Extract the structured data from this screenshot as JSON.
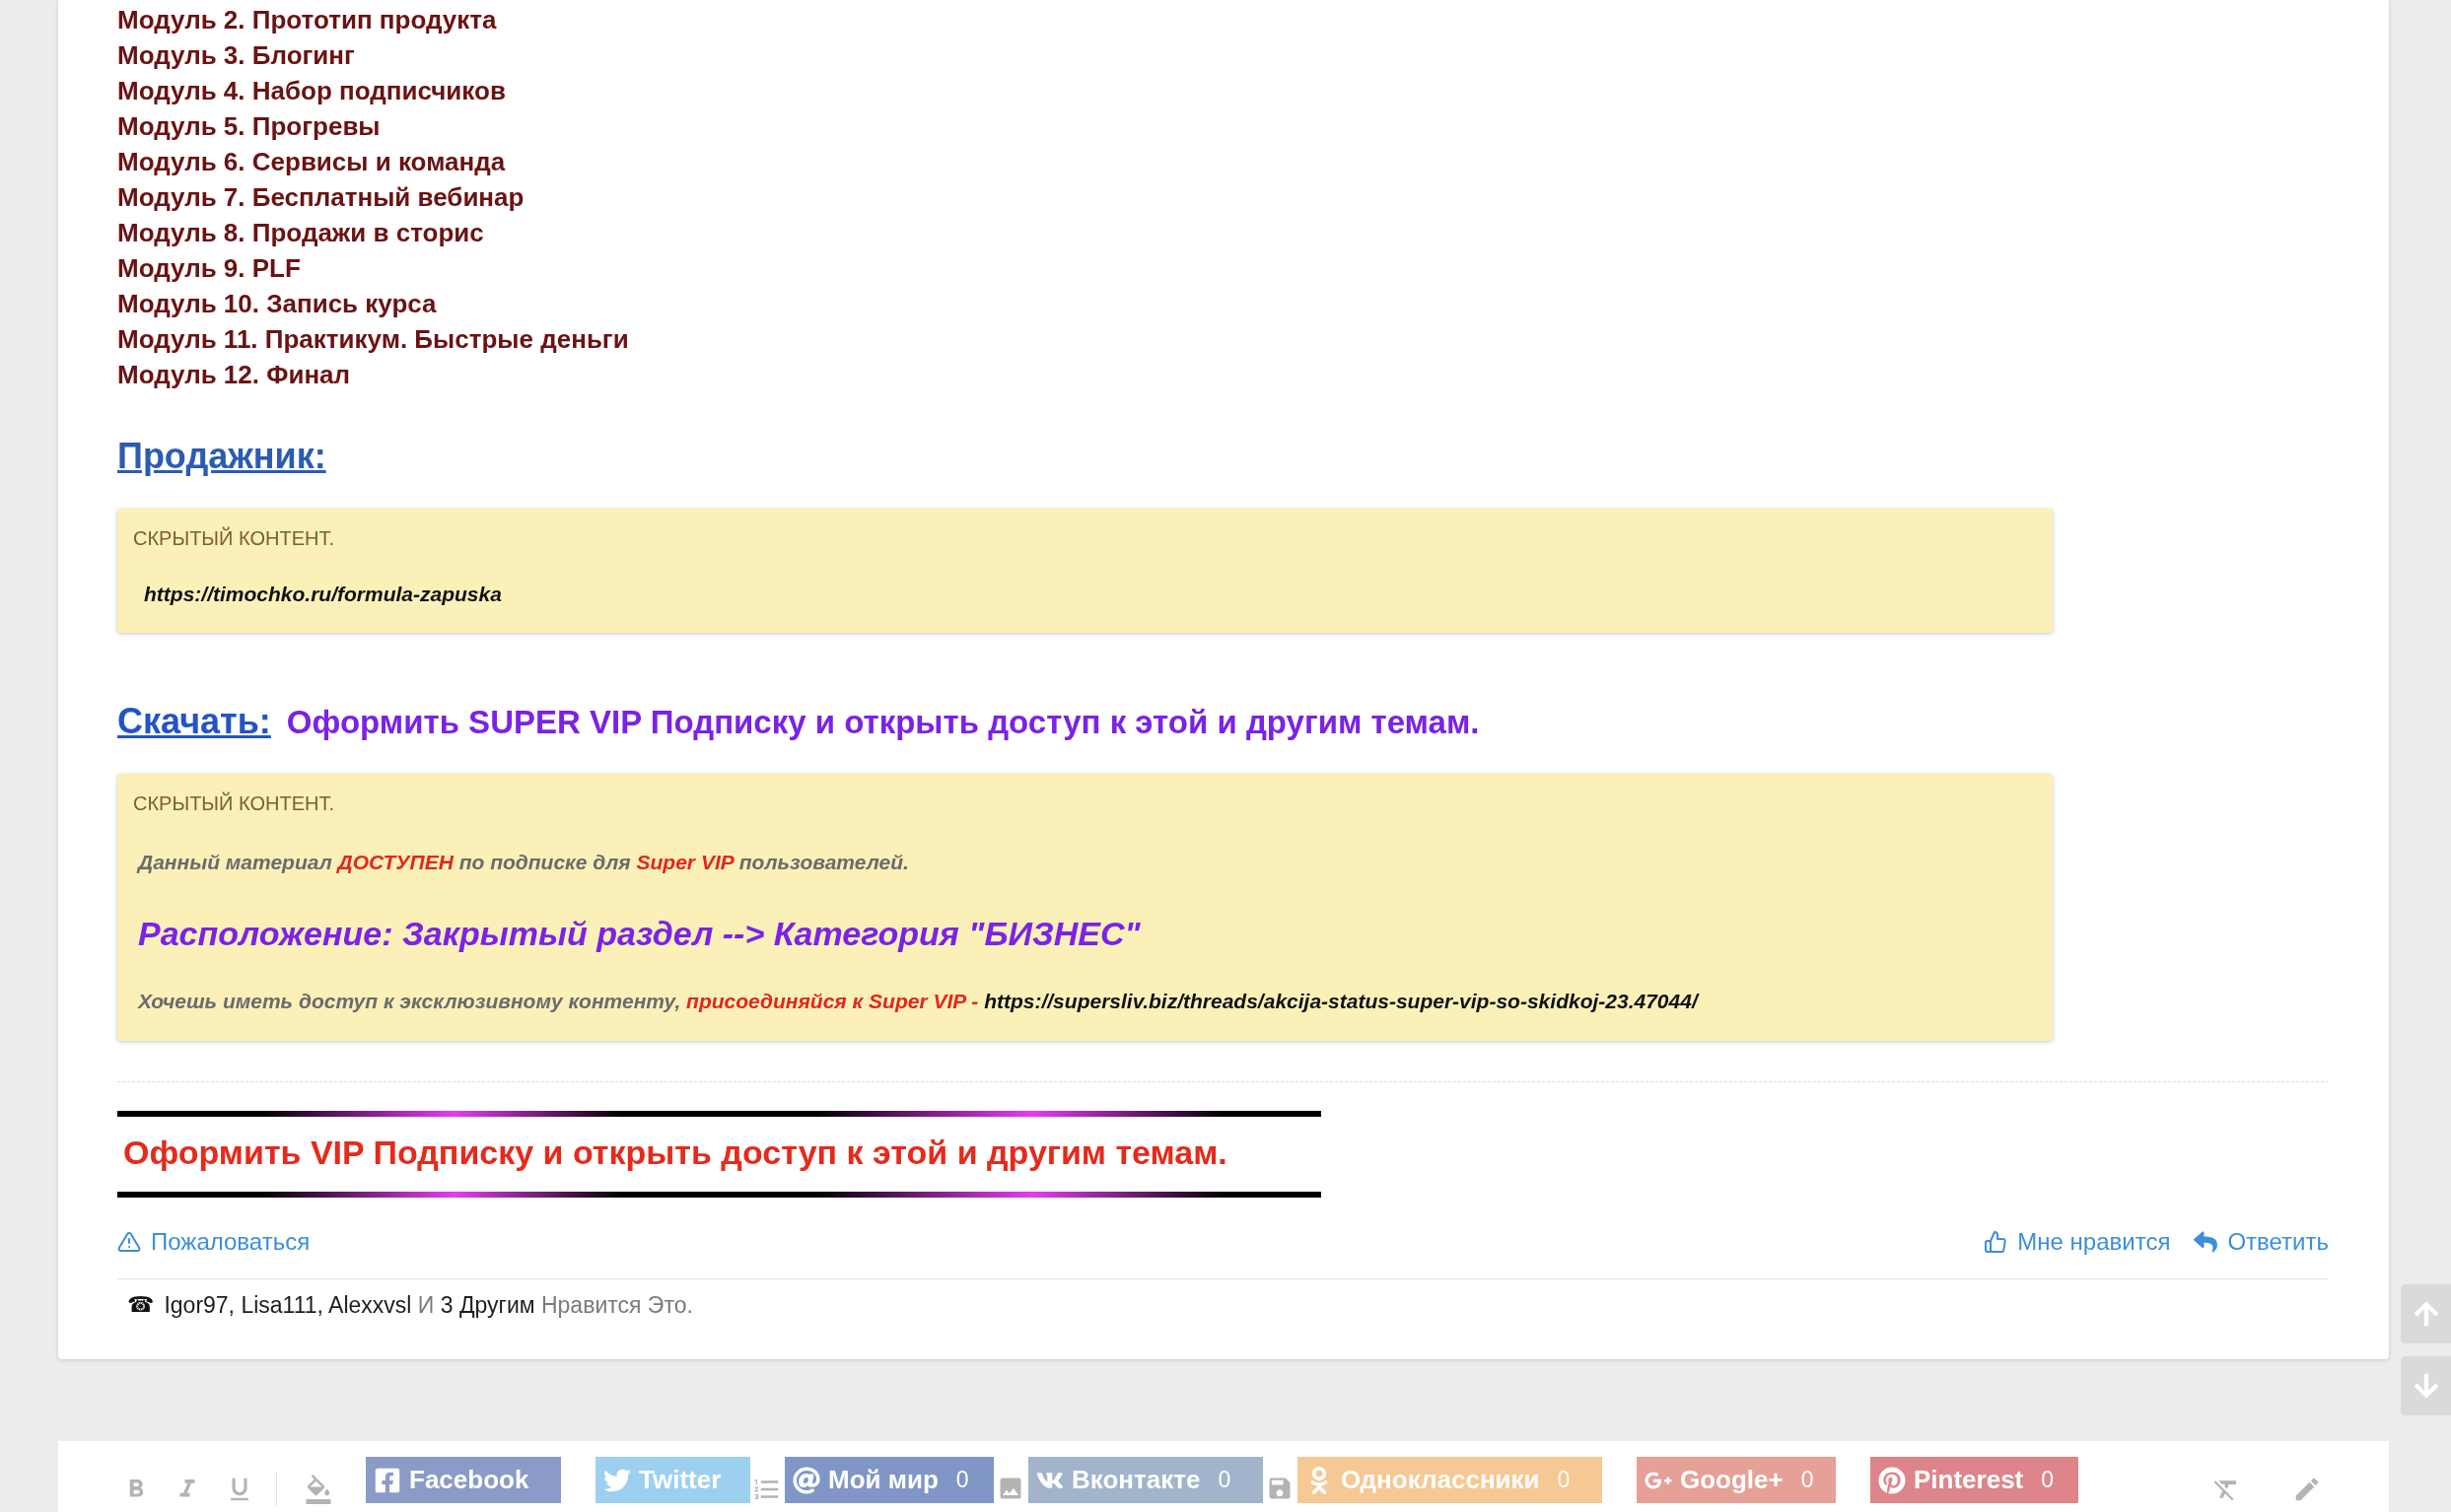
{
  "course_modules": [
    "Модуль 2. Прототип продукта",
    "Модуль 3. Блогинг",
    "Модуль 4. Набор подписчиков",
    "Модуль 5. Прогревы",
    "Модуль 6. Сервисы и команда",
    "Модуль 7. Бесплатный вебинар",
    "Модуль 8. Продажи в сторис",
    "Модуль 9. PLF",
    "Модуль 10. Запись курса",
    "Модуль 11. Практикум. Быстрые деньги",
    "Модуль 12. Финал"
  ],
  "sections": [
    {
      "heading": "Продажник:",
      "hidden_content": {
        "label": "СКРЫТЫЙ КОНТЕНТ.",
        "lines": [
          {
            "kind": "url",
            "parts": [
              {
                "kind": "url",
                "text": "https://timochko.ru/formula-zapuska"
              }
            ]
          }
        ]
      }
    },
    {
      "heading": "Скачать:",
      "promo": "Оформить SUPER VIP Подписку и открыть доступ к этой и другим темам.",
      "hidden_content": {
        "label": "СКРЫТЫЙ КОНТЕНТ.",
        "lines": [
          {
            "kind": "note",
            "parts": [
              {
                "kind": "plain",
                "text": "Данный материал"
              },
              {
                "kind": "accent",
                "text": "ДОСТУПЕН"
              },
              {
                "kind": "plain",
                "text": "по подписке для"
              },
              {
                "kind": "accent",
                "text": "Super VIP"
              },
              {
                "kind": "plain",
                "text": "пользователей."
              }
            ]
          },
          {
            "kind": "location",
            "parts": [
              {
                "kind": "plain",
                "text": "Расположение: Закрытый раздел --> Категория \"БИЗНЕС\""
              }
            ]
          },
          {
            "kind": "note",
            "parts": [
              {
                "kind": "plain",
                "text": "Хочешь иметь доступ к эксклюзивному контенту,"
              },
              {
                "kind": "accent",
                "text": "присоединяйся к Super VIP -"
              },
              {
                "kind": "url",
                "text": "https://supersliv.biz/threads/akcija-status-super-vip-so-skidkoj-23.47044/"
              }
            ]
          }
        ]
      }
    }
  ],
  "vip_banner": {
    "text": "Оформить VIP Подписку и открыть доступ к этой и другим темам."
  },
  "post_actions": {
    "report": "Пожаловаться",
    "like": "Мне нравится",
    "reply": "Ответить"
  },
  "likes": {
    "marker": "☎",
    "parts": [
      {
        "kind": "name",
        "text": "Igor97, Lisa111, Alexxvsl"
      },
      {
        "kind": "muted",
        "text": "И"
      },
      {
        "kind": "name",
        "text": "3 Другим"
      },
      {
        "kind": "muted",
        "text": "Нравится Это."
      }
    ]
  },
  "share_buttons": [
    {
      "label": "Facebook",
      "color": "#8b9bc8"
    },
    {
      "label": "Twitter",
      "color": "#9dd0ee"
    },
    {
      "label": "Мой мир",
      "count": "0",
      "color": "#7f96c6"
    },
    {
      "label": "Вконтакте",
      "count": "0",
      "color": "#a1b4cb"
    },
    {
      "label": "Одноклассники",
      "count": "0",
      "color": "#f6c893"
    },
    {
      "label": "Google+",
      "count": "0",
      "color": "#e5a097"
    },
    {
      "label": "Pinterest",
      "count": "0",
      "color": "#dd858a"
    }
  ]
}
